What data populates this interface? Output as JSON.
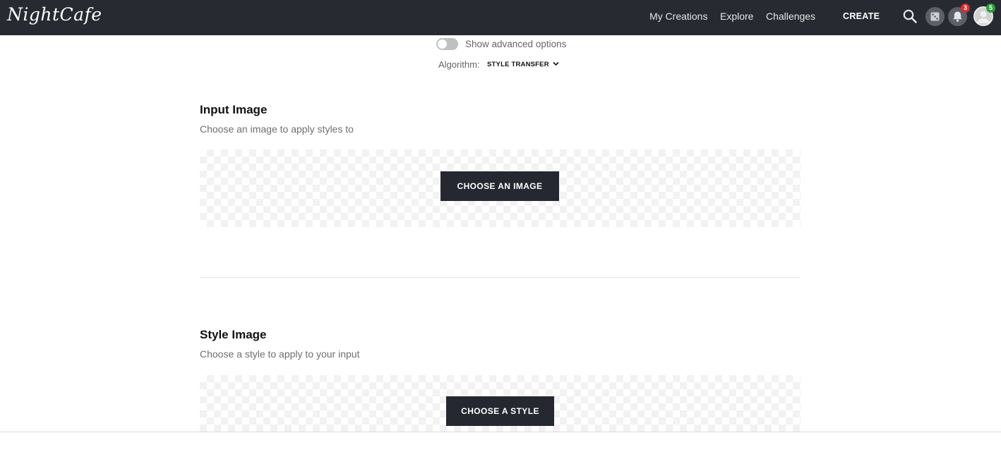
{
  "header": {
    "logo": "NightCafe",
    "nav": [
      "My Creations",
      "Explore",
      "Challenges"
    ],
    "create_label": "CREATE",
    "notifications_count": "3",
    "profile_badge": "5"
  },
  "options": {
    "toggle_label": "Show advanced options",
    "algorithm_label": "Algorithm:",
    "algorithm_value": "STYLE TRANSFER"
  },
  "input_section": {
    "title": "Input Image",
    "subtitle": "Choose an image to apply styles to",
    "button_label": "CHOOSE AN IMAGE"
  },
  "style_section": {
    "title": "Style Image",
    "subtitle": "Choose a style to apply to your input",
    "button_label": "CHOOSE A STYLE"
  },
  "colors": {
    "header_bg": "#272a31",
    "button_bg": "#252830",
    "badge_red": "#d32f2f",
    "badge_green": "#2e9e3e"
  }
}
